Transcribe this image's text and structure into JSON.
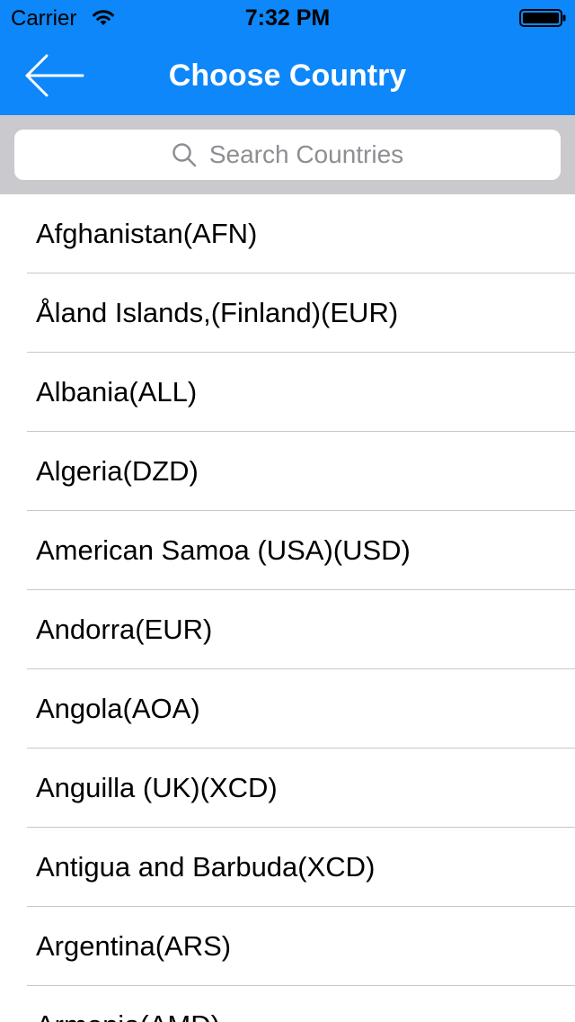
{
  "status_bar": {
    "carrier": "Carrier",
    "time": "7:32 PM",
    "wifi_icon": "wifi-icon",
    "battery_icon": "battery-icon"
  },
  "nav": {
    "title": "Choose Country",
    "back_icon": "back-arrow-icon",
    "background_color": "#0d87f9"
  },
  "search": {
    "placeholder": "Search Countries",
    "icon": "search-icon"
  },
  "countries": [
    {
      "label": "Afghanistan(AFN)"
    },
    {
      "label": "Åland Islands,(Finland)(EUR)"
    },
    {
      "label": "Albania(ALL)"
    },
    {
      "label": "Algeria(DZD)"
    },
    {
      "label": "American Samoa (USA)(USD)"
    },
    {
      "label": "Andorra(EUR)"
    },
    {
      "label": "Angola(AOA)"
    },
    {
      "label": "Anguilla (UK)(XCD)"
    },
    {
      "label": "Antigua and Barbuda(XCD)"
    },
    {
      "label": "Argentina(ARS)"
    },
    {
      "label": "Armenia(AMD)"
    }
  ]
}
